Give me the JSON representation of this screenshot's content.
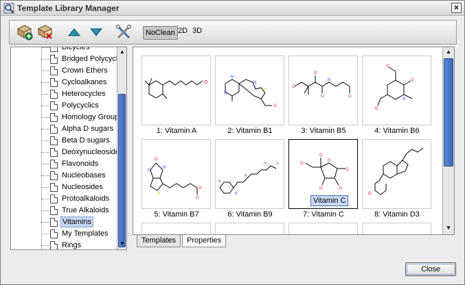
{
  "window": {
    "title": "Template Library Manager"
  },
  "toolbar": {
    "buttons": [
      {
        "icon": "add-library-icon"
      },
      {
        "icon": "remove-library-icon"
      },
      {
        "icon": "move-up-icon"
      },
      {
        "icon": "move-down-icon"
      },
      {
        "icon": "settings-tools-icon"
      }
    ],
    "noclean_label": "NoClean",
    "label_2d": "2D",
    "label_3d": "3D"
  },
  "tree": {
    "items": [
      {
        "label": "Bicycles"
      },
      {
        "label": "Bridged Polycyclics"
      },
      {
        "label": "Crown Ethers"
      },
      {
        "label": "Cycloalkanes"
      },
      {
        "label": "Heterocycles"
      },
      {
        "label": "Polycyclics"
      },
      {
        "label": "Homology Groups"
      },
      {
        "label": "Alpha D sugars"
      },
      {
        "label": "Beta D sugars"
      },
      {
        "label": "Deoxynucleosides"
      },
      {
        "label": "Flavonoids"
      },
      {
        "label": "Nucleobases"
      },
      {
        "label": "Nucleosides"
      },
      {
        "label": "Protoalkaloids"
      },
      {
        "label": "True Alkaloids"
      },
      {
        "label": "Vitamins",
        "selected": true
      },
      {
        "label": "My Templates"
      },
      {
        "label": "Rings"
      }
    ]
  },
  "gallery": {
    "items": [
      {
        "caption": "1: Vitamin A"
      },
      {
        "caption": "2: Vitamin B1"
      },
      {
        "caption": "3: Vitamin B5"
      },
      {
        "caption": "4: Vitamin B6"
      },
      {
        "caption": "5: Vitamin B7"
      },
      {
        "caption": "6: Vitamin B9"
      },
      {
        "caption": "7: Vitamin C",
        "selected": true
      },
      {
        "caption": "8: Vitamin D3"
      }
    ],
    "tooltip": "Vitamin C"
  },
  "tabs": [
    {
      "label": "Templates"
    },
    {
      "label": "Properties",
      "active": true
    }
  ],
  "footer": {
    "close_label": "Close"
  },
  "colors": {
    "selection": "#c4d6f2",
    "scroll_thumb": "#4a74c0",
    "oxygen": "#e02020",
    "nitrogen": "#3050f8",
    "sulfur": "#c8c800"
  }
}
